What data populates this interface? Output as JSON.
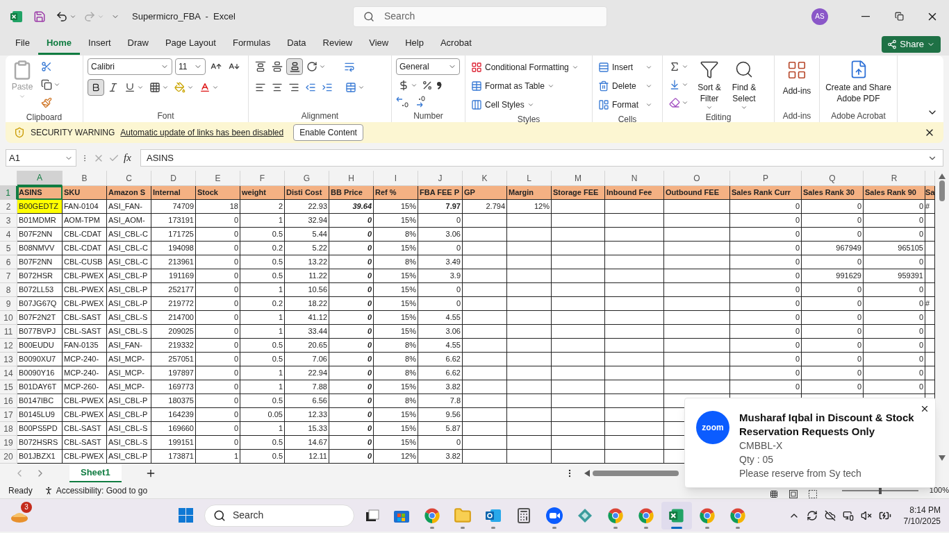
{
  "title_bar": {
    "title": "Supermicro_FBA  -  Excel",
    "search_placeholder": "Search",
    "avatar_initials": "AS"
  },
  "menu_tabs": [
    {
      "label": "File",
      "selected": false
    },
    {
      "label": "Home",
      "selected": true
    },
    {
      "label": "Insert",
      "selected": false
    },
    {
      "label": "Draw",
      "selected": false
    },
    {
      "label": "Page Layout",
      "selected": false
    },
    {
      "label": "Formulas",
      "selected": false
    },
    {
      "label": "Data",
      "selected": false
    },
    {
      "label": "Review",
      "selected": false
    },
    {
      "label": "View",
      "selected": false
    },
    {
      "label": "Help",
      "selected": false
    },
    {
      "label": "Acrobat",
      "selected": false
    }
  ],
  "share_button": "Share",
  "ribbon": {
    "groups": [
      {
        "kind": "clipboard",
        "label": "Clipboard",
        "paste": "Paste"
      },
      {
        "kind": "font",
        "label": "Font",
        "font_name": "Calibri",
        "font_size": "11",
        "bold_selected": true
      },
      {
        "kind": "alignment",
        "label": "Alignment",
        "bottom_align_selected": true
      },
      {
        "kind": "number",
        "label": "Number",
        "format": "General"
      },
      {
        "kind": "styles",
        "label": "Styles",
        "buttons": [
          "Conditional Formatting",
          "Format as Table",
          "Cell Styles"
        ]
      },
      {
        "kind": "cells",
        "label": "Cells",
        "buttons": [
          "Insert",
          "Delete",
          "Format"
        ]
      },
      {
        "kind": "editing",
        "label": "Editing",
        "buttons": [
          "Sort & Filter",
          "Find & Select"
        ]
      },
      {
        "kind": "addins",
        "label": "Add-ins",
        "button": "Add-ins"
      },
      {
        "kind": "acrobat",
        "label": "Adobe Acrobat",
        "button": "Create and Share Adobe PDF"
      }
    ]
  },
  "security_bar": {
    "title": "SECURITY WARNING",
    "message": "Automatic update of links has been disabled",
    "button": "Enable Content"
  },
  "formula_bar": {
    "name_box": "A1",
    "function_label": "fx",
    "value": "ASINS"
  },
  "columns": [
    {
      "letter": "A",
      "header": "ASINS",
      "selected": true
    },
    {
      "letter": "B",
      "header": "SKU",
      "selected": false
    },
    {
      "letter": "C",
      "header": "Amazon S",
      "selected": false
    },
    {
      "letter": "D",
      "header": "Internal",
      "selected": false
    },
    {
      "letter": "E",
      "header": "Stock",
      "selected": false
    },
    {
      "letter": "F",
      "header": "weight",
      "selected": false
    },
    {
      "letter": "G",
      "header": "Disti Cost",
      "selected": false
    },
    {
      "letter": "H",
      "header": "BB Price",
      "selected": false
    },
    {
      "letter": "I",
      "header": "Ref %",
      "selected": false
    },
    {
      "letter": "J",
      "header": "FBA FEE P",
      "selected": false
    },
    {
      "letter": "K",
      "header": "GP",
      "selected": false
    },
    {
      "letter": "L",
      "header": "Margin",
      "selected": false
    },
    {
      "letter": "M",
      "header": "Storage FEE",
      "selected": false
    },
    {
      "letter": "N",
      "header": "Inbound Fee",
      "selected": false
    },
    {
      "letter": "O",
      "header": "Outbound FEE",
      "selected": false
    },
    {
      "letter": "P",
      "header": "Sales Rank Curr",
      "selected": false
    },
    {
      "letter": "Q",
      "header": "Sales Rank 30",
      "selected": false
    },
    {
      "letter": "R",
      "header": "Sales Rank 90",
      "selected": false
    },
    {
      "header": "Sa",
      "selected": false
    }
  ],
  "header_row": {
    "number": "1",
    "selected": true
  },
  "rows": [
    {
      "number": "2",
      "selected": false,
      "cells": {
        "A": {
          "text": "B00GEDTZ",
          "bold": false,
          "highlighted": true
        },
        "B": "FAN-0104",
        "C": "ASI_FAN-",
        "D": "74709",
        "E": "18",
        "F": "2",
        "G": "22.93",
        "H": "39.64",
        "I": "15%",
        "J": {
          "text": "7.97",
          "bold": true,
          "highlighted": false
        },
        "K": "2.794",
        "L": "12%",
        "P": "0",
        "Q": "0",
        "R": "0",
        "S": "#"
      }
    },
    {
      "number": "3",
      "selected": false,
      "cells": {
        "A": "B01MDMR",
        "B": "AOM-TPM",
        "C": "ASI_AOM-",
        "D": "173191",
        "E": "0",
        "F": "1",
        "G": "32.94",
        "H": "0",
        "I": "15%",
        "J": "0",
        "P": "0",
        "Q": "0",
        "R": "0"
      }
    },
    {
      "number": "4",
      "selected": false,
      "cells": {
        "A": "B07F2NN",
        "B": "CBL-CDAT",
        "C": "ASI_CBL-C",
        "D": "171725",
        "E": "0",
        "F": "0.5",
        "G": "5.44",
        "H": "0",
        "I": "8%",
        "J": "3.06",
        "P": "0",
        "Q": "0",
        "R": "0"
      }
    },
    {
      "number": "5",
      "selected": false,
      "cells": {
        "A": "B08NMVV",
        "B": "CBL-CDAT",
        "C": "ASI_CBL-C",
        "D": "194098",
        "E": "0",
        "F": "0.2",
        "G": "5.22",
        "H": "0",
        "I": "15%",
        "J": "0",
        "P": "0",
        "Q": "967949",
        "R": "965105"
      }
    },
    {
      "number": "6",
      "selected": false,
      "cells": {
        "A": "B07F2NN",
        "B": "CBL-CUSB",
        "C": "ASI_CBL-C",
        "D": "213961",
        "E": "0",
        "F": "0.5",
        "G": "13.22",
        "H": "0",
        "I": "8%",
        "J": "3.49",
        "P": "0",
        "Q": "0",
        "R": "0"
      }
    },
    {
      "number": "7",
      "selected": false,
      "cells": {
        "A": "B072HSR",
        "B": "CBL-PWEX",
        "C": "ASI_CBL-P",
        "D": "191169",
        "E": "0",
        "F": "0.5",
        "G": "11.22",
        "H": "0",
        "I": "15%",
        "J": "3.9",
        "P": "0",
        "Q": "991629",
        "R": "959391"
      }
    },
    {
      "number": "8",
      "selected": false,
      "cells": {
        "A": "B072LL53",
        "B": "CBL-PWEX",
        "C": "ASI_CBL-P",
        "D": "252177",
        "E": "0",
        "F": "1",
        "G": "10.56",
        "H": "0",
        "I": "15%",
        "J": "0",
        "P": "0",
        "Q": "0",
        "R": "0"
      }
    },
    {
      "number": "9",
      "selected": false,
      "cells": {
        "A": "B07JG67Q",
        "B": "CBL-PWEX",
        "C": "ASI_CBL-P",
        "D": "219772",
        "E": "0",
        "F": "0.2",
        "G": "18.22",
        "H": "0",
        "I": "15%",
        "J": "0",
        "P": "0",
        "Q": "0",
        "R": "0",
        "S": "#"
      }
    },
    {
      "number": "10",
      "selected": false,
      "cells": {
        "A": "B07F2N2T",
        "B": "CBL-SAST",
        "C": "ASI_CBL-S",
        "D": "214700",
        "E": "0",
        "F": "1",
        "G": "41.12",
        "H": "0",
        "I": "15%",
        "J": "4.55",
        "P": "0",
        "Q": "0",
        "R": "0"
      }
    },
    {
      "number": "11",
      "selected": false,
      "cells": {
        "A": "B077BVPJ",
        "B": "CBL-SAST",
        "C": "ASI_CBL-S",
        "D": "209025",
        "E": "0",
        "F": "1",
        "G": "33.44",
        "H": "0",
        "I": "15%",
        "J": "3.06",
        "P": "0",
        "Q": "0",
        "R": "0"
      }
    },
    {
      "number": "12",
      "selected": false,
      "cells": {
        "A": "B00EUDU",
        "B": "FAN-0135",
        "C": "ASI_FAN-",
        "D": "219332",
        "E": "0",
        "F": "0.5",
        "G": "20.65",
        "H": "0",
        "I": "8%",
        "J": "4.55",
        "P": "0",
        "Q": "0",
        "R": "0"
      }
    },
    {
      "number": "13",
      "selected": false,
      "cells": {
        "A": "B0090XU7",
        "B": "MCP-240-",
        "C": "ASI_MCP-",
        "D": "257051",
        "E": "0",
        "F": "0.5",
        "G": "7.06",
        "H": "0",
        "I": "8%",
        "J": "6.62",
        "P": "0",
        "Q": "0",
        "R": "0"
      }
    },
    {
      "number": "14",
      "selected": false,
      "cells": {
        "A": "B0090Y16",
        "B": "MCP-240-",
        "C": "ASI_MCP-",
        "D": "197897",
        "E": "0",
        "F": "1",
        "G": "22.94",
        "H": "0",
        "I": "8%",
        "J": "6.62",
        "P": "0",
        "Q": "0",
        "R": "0"
      }
    },
    {
      "number": "15",
      "selected": false,
      "cells": {
        "A": "B01DAY6T",
        "B": "MCP-260-",
        "C": "ASI_MCP-",
        "D": "169773",
        "E": "0",
        "F": "1",
        "G": "7.88",
        "H": "0",
        "I": "15%",
        "J": "3.82",
        "P": "0",
        "Q": "0",
        "R": "0"
      }
    },
    {
      "number": "16",
      "selected": false,
      "cells": {
        "A": "B0147IBC",
        "B": "CBL-PWEX",
        "C": "ASI_CBL-P",
        "D": "180375",
        "E": "0",
        "F": "0.5",
        "G": "6.56",
        "H": "0",
        "I": "8%",
        "J": "7.8"
      }
    },
    {
      "number": "17",
      "selected": false,
      "cells": {
        "A": "B0145LU9",
        "B": "CBL-PWEX",
        "C": "ASI_CBL-P",
        "D": "164239",
        "E": "0",
        "F": "0.05",
        "G": "12.33",
        "H": "0",
        "I": "15%",
        "J": "9.56"
      }
    },
    {
      "number": "18",
      "selected": false,
      "cells": {
        "A": "B00PS5PD",
        "B": "CBL-SAST",
        "C": "ASI_CBL-S",
        "D": "169660",
        "E": "0",
        "F": "1",
        "G": "15.33",
        "H": "0",
        "I": "15%",
        "J": "5.87"
      }
    },
    {
      "number": "19",
      "selected": false,
      "cells": {
        "A": "B072HSRS",
        "B": "CBL-SAST",
        "C": "ASI_CBL-S",
        "D": "199151",
        "E": "0",
        "F": "0.5",
        "G": "14.67",
        "H": "0",
        "I": "15%",
        "J": "0"
      }
    },
    {
      "number": "20",
      "selected": false,
      "cells": {
        "A": "B01JBZX1",
        "B": "CBL-PWEX",
        "C": "ASI_CBL-P",
        "D": "173871",
        "E": "1",
        "F": "0.5",
        "G": "12.11",
        "H": "0",
        "I": "12%",
        "J": "3.82"
      }
    }
  ],
  "sheet_tabs": [
    {
      "label": "Sheet1",
      "selected": true
    }
  ],
  "status_bar": {
    "ready": "Ready",
    "accessibility": "Accessibility: Good to go",
    "zoom_slider": {
      "level": 0.5
    },
    "zoom": "100%"
  },
  "notification": {
    "app_logo": "zoom",
    "title": "Musharaf Iqbal in Discount & Stock Reservation Requests Only",
    "lines": [
      "CMBBL-X",
      "Qty : 05",
      "Please reserve from Sy tech"
    ]
  },
  "taskbar": {
    "items": [
      {
        "kind": "widgets",
        "badge": "3",
        "selected": false
      },
      {
        "kind": "start",
        "selected": false
      },
      {
        "kind": "search",
        "label": "Search",
        "selected": false
      },
      {
        "kind": "taskview",
        "selected": false
      },
      {
        "kind": "store",
        "selected": false
      },
      {
        "kind": "chrome",
        "selected": false
      },
      {
        "kind": "folder",
        "selected": false
      },
      {
        "kind": "outlook",
        "selected": false
      },
      {
        "kind": "calculator",
        "selected": false
      },
      {
        "kind": "zoom",
        "selected": false
      },
      {
        "kind": "app",
        "selected": false
      },
      {
        "kind": "chrome",
        "selected": false
      },
      {
        "kind": "chrome",
        "selected": false
      },
      {
        "kind": "excel",
        "selected": true
      },
      {
        "kind": "chrome",
        "selected": false
      },
      {
        "kind": "chrome",
        "selected": false
      }
    ],
    "time": "8:14 PM",
    "date": "7/10/2025"
  }
}
